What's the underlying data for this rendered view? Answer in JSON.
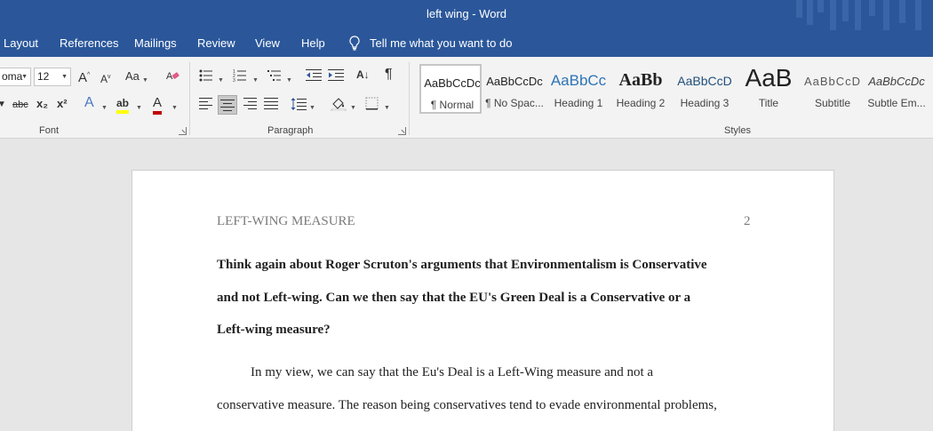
{
  "window": {
    "title": "left wing  -  Word",
    "accent": "#2b579a"
  },
  "tabs": [
    {
      "label": "Layout"
    },
    {
      "label": "References"
    },
    {
      "label": "Mailings"
    },
    {
      "label": "Review"
    },
    {
      "label": "View"
    },
    {
      "label": "Help"
    }
  ],
  "tell_me": {
    "text": "Tell me what you want to do",
    "icon": "lightbulb-icon"
  },
  "ribbon": {
    "font": {
      "name_value": "oma",
      "size_value": "12",
      "group_label": "Font",
      "icons": [
        "grow-font-icon",
        "shrink-font-icon",
        "change-case-icon",
        "clear-formatting-icon",
        "strikethrough-icon",
        "subscript-icon",
        "superscript-icon",
        "text-effects-icon",
        "highlight-icon",
        "font-color-icon"
      ],
      "labels": {
        "change_case": "Aa",
        "strike": "abc",
        "sub": "x₂",
        "sup": "x²",
        "effects": "A",
        "highlight": "ab",
        "color": "A"
      }
    },
    "paragraph": {
      "group_label": "Paragraph",
      "icons": [
        "bullets-icon",
        "numbering-icon",
        "multilevel-list-icon",
        "decrease-indent-icon",
        "increase-indent-icon",
        "sort-icon",
        "show-marks-icon",
        "align-left-icon",
        "center-icon",
        "align-right-icon",
        "justify-icon",
        "line-spacing-icon",
        "shading-icon",
        "borders-icon"
      ],
      "show_marks": "¶"
    },
    "styles": {
      "group_label": "Styles",
      "items": [
        {
          "preview": "AaBbCcDc",
          "name": "¶ Normal",
          "active": true
        },
        {
          "preview": "AaBbCcDc",
          "name": "¶ No Spac..."
        },
        {
          "preview": "AaBbCc",
          "name": "Heading 1",
          "color": "#2e74b5"
        },
        {
          "preview": "AaBb",
          "name": "Heading 2"
        },
        {
          "preview": "AaBbCcD",
          "name": "Heading 3",
          "color": "#1f4e79"
        },
        {
          "preview": "AaB",
          "name": "Title"
        },
        {
          "preview": "AaBbCcD",
          "name": "Subtitle",
          "color": "#595959"
        },
        {
          "preview": "AaBbCcDc",
          "name": "Subtle Em..."
        }
      ]
    }
  },
  "document": {
    "header_left": "LEFT-WING MEASURE",
    "page_number": "2",
    "question_lines": [
      "Think again about Roger Scruton's arguments that Environmentalism is Conservative",
      "and not Left-wing. Can we then say that the EU's Green Deal is a Conservative or a",
      "Left-wing measure?"
    ],
    "body_lines": [
      "In my view, we can say that the Eu's Deal is a Left-Wing measure and not a",
      "conservative measure. The reason being conservatives tend to evade environmental problems,"
    ]
  }
}
